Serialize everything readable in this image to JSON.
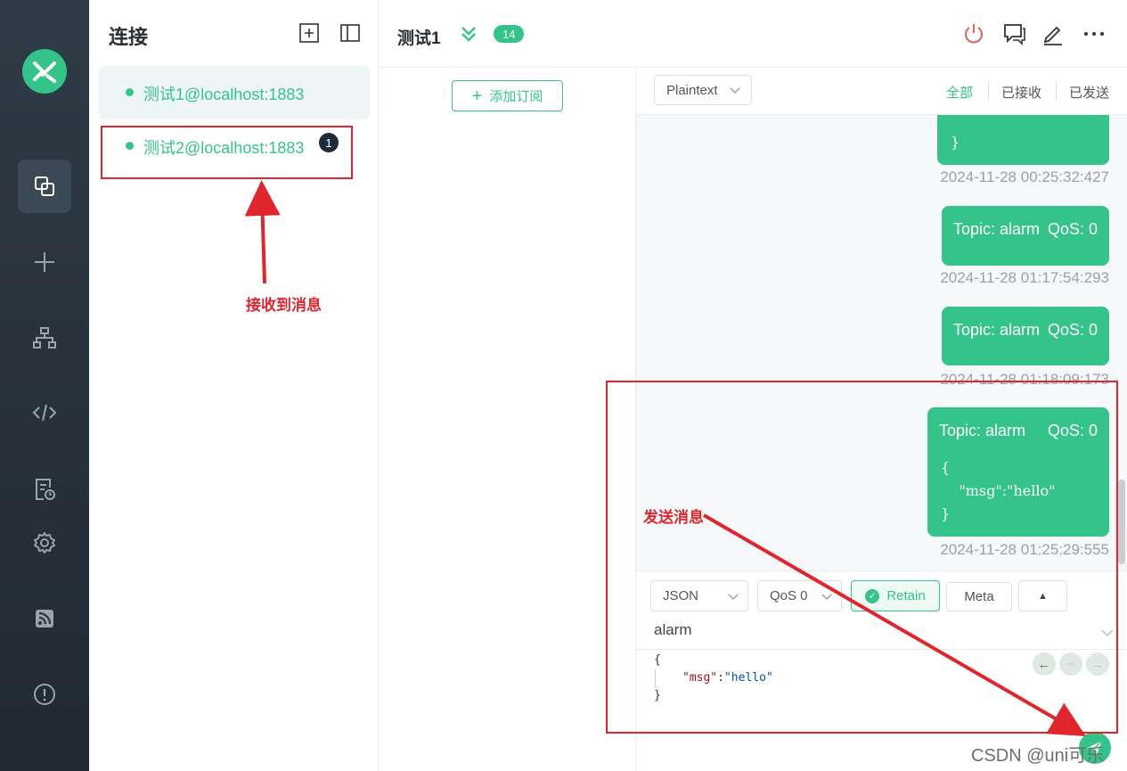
{
  "sidebar": {
    "nav": [
      "connections-icon",
      "plus-icon",
      "topology-icon",
      "code-icon",
      "log-icon",
      "settings-icon",
      "subscribe-icon",
      "about-icon"
    ]
  },
  "connections": {
    "title": "连接",
    "items": [
      {
        "label": "测试1@localhost:1883",
        "active": true
      },
      {
        "label": "测试2@localhost:1883",
        "badge": "1"
      }
    ]
  },
  "header": {
    "name": "测试1",
    "count": "14"
  },
  "subscriptions": {
    "add_label": "添加订阅"
  },
  "messages": {
    "format": "Plaintext",
    "filters": [
      "全部",
      "已接收",
      "已发送"
    ],
    "list": [
      {
        "payload": "}",
        "time": "2024-11-28 00:25:32:427"
      },
      {
        "topic": "Topic: alarm",
        "qos": "QoS: 0",
        "time": "2024-11-28 01:17:54:293"
      },
      {
        "topic": "Topic: alarm",
        "qos": "QoS: 0",
        "time": "2024-11-28 01:18:09:173"
      },
      {
        "topic": "Topic: alarm",
        "qos": "QoS: 0",
        "payload": "{\n    \"msg\":\"hello\"\n}",
        "time": "2024-11-28 01:25:29:555"
      }
    ]
  },
  "composer": {
    "payload_type": "JSON",
    "qos": "QoS 0",
    "retain_label": "Retain",
    "meta_label": "Meta",
    "topic": "alarm",
    "payload_lines": [
      "{",
      "\"msg\":\"hello\"",
      "}"
    ]
  },
  "annotations": {
    "received": "接收到消息",
    "send": "发送消息"
  },
  "watermark": "CSDN @uni可乐",
  "colors": {
    "accent": "#34c388",
    "rail": "#2b3640",
    "annotation": "#e0262c"
  }
}
